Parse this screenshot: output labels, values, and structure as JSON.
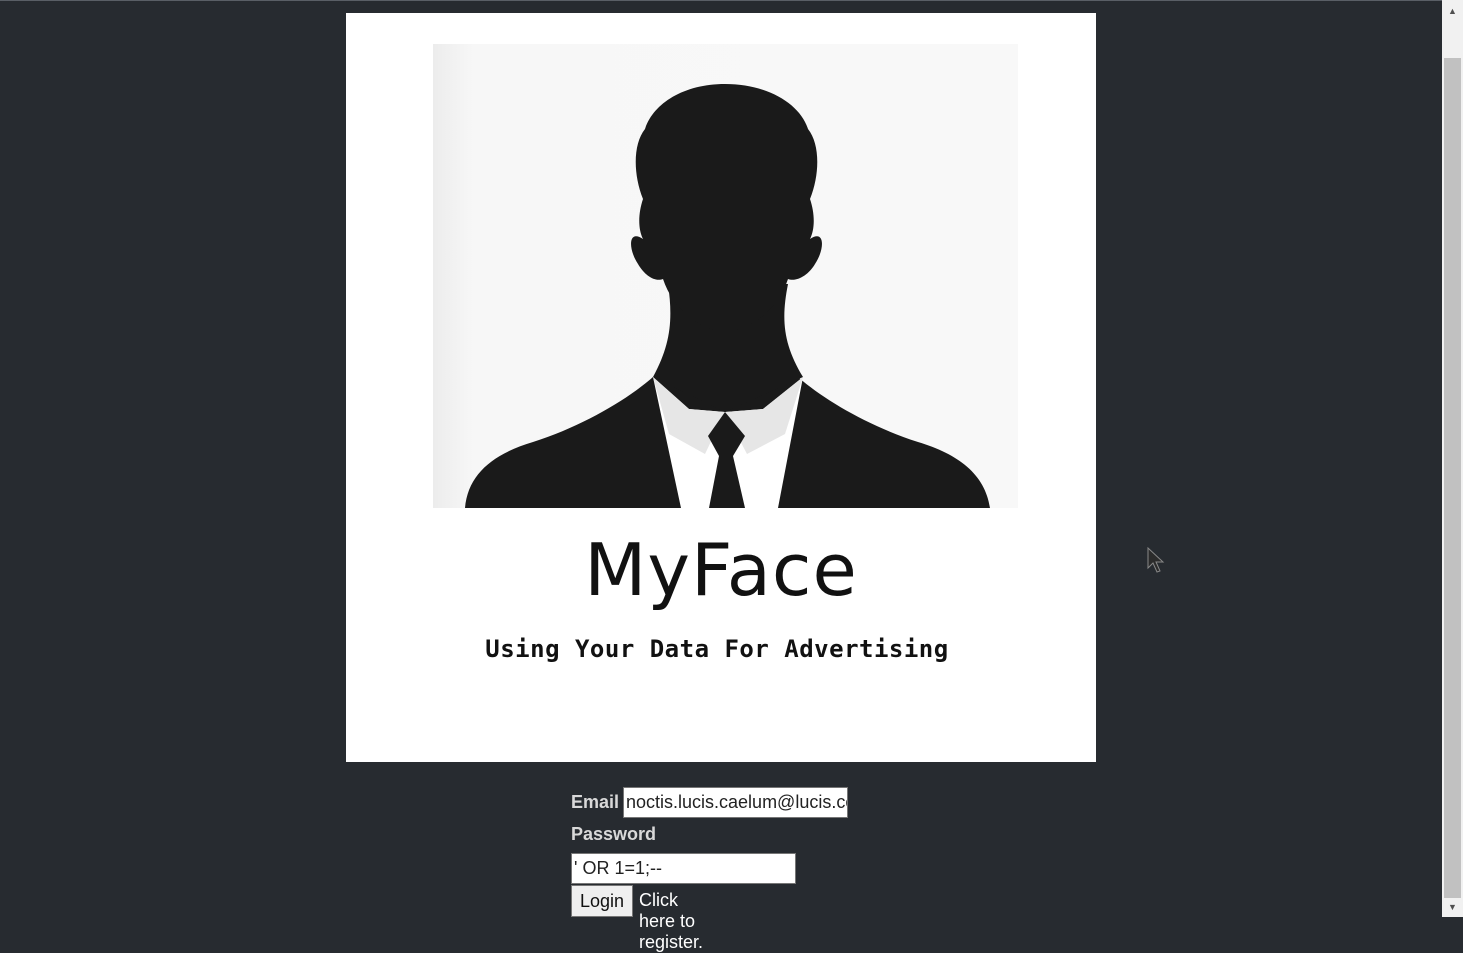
{
  "brand": {
    "title": "MyFace",
    "tagline": "Using Your Data For Advertising",
    "logo_icon": "person-silhouette-icon"
  },
  "login_form": {
    "email_label": "Email",
    "email_value": "noctis.lucis.caelum@lucis.co",
    "password_label": "Password",
    "password_value": "' OR 1=1;--",
    "login_button": "Login",
    "register_link": "Click here to register."
  },
  "scrollbar": {
    "up_icon": "▲",
    "down_icon": "▼"
  },
  "colors": {
    "background": "#272b30",
    "card": "#ffffff",
    "label": "#d9d9d9"
  }
}
